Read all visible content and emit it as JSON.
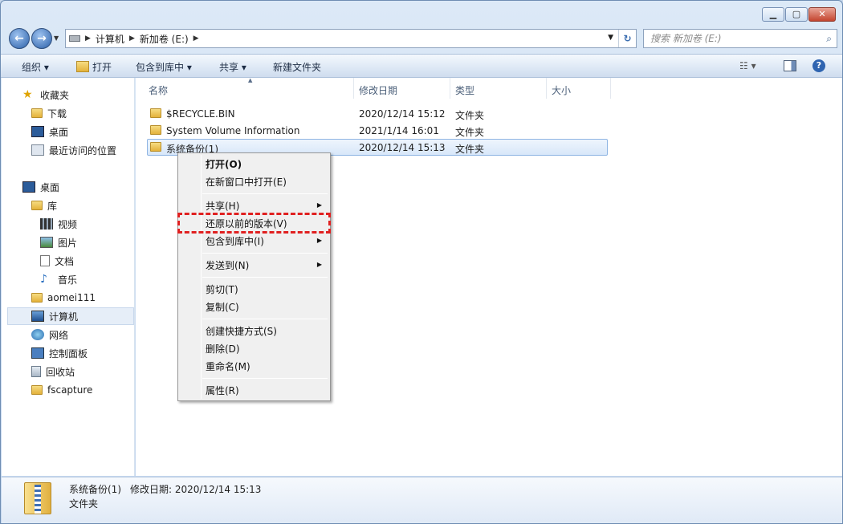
{
  "window": {
    "caption_buttons": [
      "minimize",
      "maximize",
      "close"
    ]
  },
  "address": {
    "crumbs": [
      "计算机",
      "新加卷 (E:)"
    ],
    "search_placeholder": "搜索 新加卷 (E:)"
  },
  "toolbar": {
    "organize": "组织 ▾",
    "open": "打开",
    "include": "包含到库中 ▾",
    "share": "共享 ▾",
    "new_folder": "新建文件夹"
  },
  "sidebar": {
    "favorites": "收藏夹",
    "downloads": "下载",
    "desktop_fav": "桌面",
    "recent": "最近访问的位置",
    "desktop": "桌面",
    "library": "库",
    "videos": "视频",
    "pictures": "图片",
    "documents": "文档",
    "music": "音乐",
    "user": "aomei111",
    "computer": "计算机",
    "network": "网络",
    "control_panel": "控制面板",
    "recycle": "回收站",
    "fscapture": "fscapture"
  },
  "columns": {
    "name": "名称",
    "date": "修改日期",
    "type": "类型",
    "size": "大小"
  },
  "files": [
    {
      "name": "$RECYCLE.BIN",
      "date": "2020/12/14 15:12",
      "type": "文件夹"
    },
    {
      "name": "System Volume Information",
      "date": "2021/1/14 16:01",
      "type": "文件夹"
    },
    {
      "name": "系统备份(1)",
      "date": "2020/12/14 15:13",
      "type": "文件夹"
    }
  ],
  "context_menu": {
    "open": "打开(O)",
    "open_new": "在新窗口中打开(E)",
    "share": "共享(H)",
    "restore": "还原以前的版本(V)",
    "include": "包含到库中(I)",
    "send_to": "发送到(N)",
    "cut": "剪切(T)",
    "copy": "复制(C)",
    "shortcut": "创建快捷方式(S)",
    "delete": "删除(D)",
    "rename": "重命名(M)",
    "properties": "属性(R)"
  },
  "status": {
    "name": "系统备份(1)",
    "modified_label": "修改日期: 2020/12/14 15:13",
    "type": "文件夹"
  },
  "colors": {
    "highlight_border": "#e02020",
    "selection": "#d8e7f9"
  }
}
